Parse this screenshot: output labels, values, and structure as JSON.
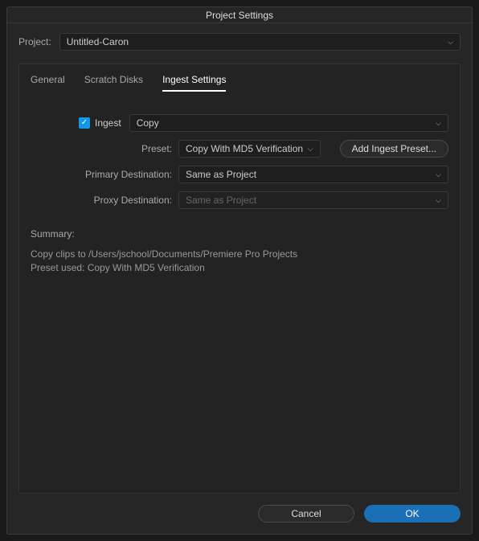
{
  "title": "Project Settings",
  "project": {
    "label": "Project:",
    "value": "Untitled-Caron"
  },
  "tabs": {
    "general": "General",
    "scratch": "Scratch Disks",
    "ingest": "Ingest Settings"
  },
  "ingest": {
    "checkbox_label": "Ingest",
    "action_value": "Copy",
    "preset_label": "Preset:",
    "preset_value": "Copy With MD5 Verification",
    "add_preset_btn": "Add Ingest Preset...",
    "primary_dest_label": "Primary Destination:",
    "primary_dest_value": "Same as Project",
    "proxy_dest_label": "Proxy Destination:",
    "proxy_dest_value": "Same as Project"
  },
  "summary": {
    "label": "Summary:",
    "line1": "Copy clips to /Users/jschool/Documents/Premiere Pro Projects",
    "line2": "Preset used: Copy With MD5 Verification"
  },
  "buttons": {
    "cancel": "Cancel",
    "ok": "OK"
  }
}
